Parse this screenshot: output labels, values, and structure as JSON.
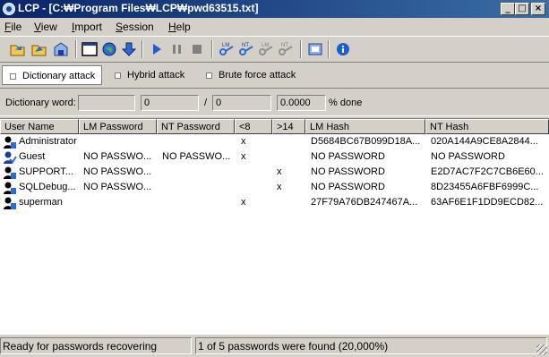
{
  "window": {
    "title": "LCP - [C:₩Program Files₩LCP₩pwd63515.txt]",
    "minimize": "_",
    "maximize": "□",
    "close": "×"
  },
  "menu": [
    {
      "label_u": "F",
      "label_rest": "ile"
    },
    {
      "label_u": "V",
      "label_rest": "iew"
    },
    {
      "label_u": "I",
      "label_rest": "mport"
    },
    {
      "label_u": "S",
      "label_rest": "ession"
    },
    {
      "label_u": "H",
      "label_rest": "elp"
    }
  ],
  "toolbar": {
    "icons": [
      "open-folder-icon",
      "open-folder-2-icon",
      "save-icon",
      "new-window-icon",
      "globe-icon",
      "download-icon",
      "play-icon",
      "pause-icon",
      "stop-icon",
      "lm-key-icon",
      "nt-key-icon",
      "lm-key-disabled-icon",
      "nt-key-disabled-icon",
      "report-icon",
      "info-icon"
    ],
    "key_labels": {
      "lm": "LM",
      "nt": "NT"
    }
  },
  "modes": {
    "dictionary": "Dictionary attack",
    "hybrid": "Hybrid attack",
    "brute": "Brute force attack"
  },
  "progress": {
    "label": "Dictionary word:",
    "word": "",
    "current": "0",
    "separator": "/",
    "total": "0",
    "percent": "0.0000",
    "percent_label": "% done"
  },
  "columns": [
    "User Name",
    "LM Password",
    "NT Password",
    "<8",
    ">14",
    "LM Hash",
    "NT Hash"
  ],
  "rows": [
    {
      "user": "Administrator",
      "lm_pw": "",
      "nt_pw": "",
      "lt8": "x",
      "gt14": "",
      "lm_hash": "D5684BC67B099D18A...",
      "nt_hash": "020A144A9CE8A2844...",
      "icon": "user-icon"
    },
    {
      "user": "Guest",
      "lm_pw": "NO PASSWO...",
      "nt_pw": "NO PASSWO...",
      "lt8": "x",
      "gt14": "",
      "lm_hash": "NO PASSWORD",
      "nt_hash": "NO PASSWORD",
      "icon": "user-check-icon"
    },
    {
      "user": "SUPPORT...",
      "lm_pw": "NO PASSWO...",
      "nt_pw": "",
      "lt8": "",
      "gt14": "x",
      "lm_hash": "NO PASSWORD",
      "nt_hash": "E2D7AC7F2C7CB6E60...",
      "icon": "user-icon"
    },
    {
      "user": "SQLDebug...",
      "lm_pw": "NO PASSWO...",
      "nt_pw": "",
      "lt8": "",
      "gt14": "x",
      "lm_hash": "NO PASSWORD",
      "nt_hash": "8D23455A6FBF6999C...",
      "icon": "user-icon"
    },
    {
      "user": "superman",
      "lm_pw": "",
      "nt_pw": "",
      "lt8": "x",
      "gt14": "",
      "lm_hash": "27F79A76DB247467A...",
      "nt_hash": "63AF6E1F1DD9ECD82...",
      "icon": "user-icon"
    }
  ],
  "status": {
    "left": "Ready for passwords recovering",
    "right": "1 of 5 passwords were found (20,000%)"
  },
  "colors": {
    "accent": "#0a246a",
    "icon_blue": "#2b6bd6"
  }
}
